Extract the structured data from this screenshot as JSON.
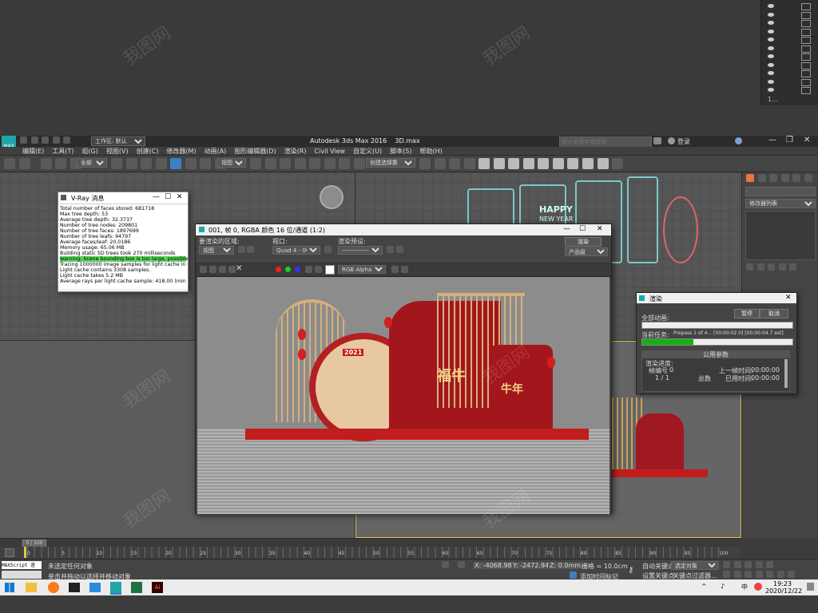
{
  "topright_panel": {
    "rows": 11,
    "ellipsis": "1..."
  },
  "app": {
    "title": "Autodesk 3ds Max 2016",
    "file": "3D.max",
    "logo": "MAX",
    "workspace": "工作区: 默认",
    "search_placeholder": "键入关键字或短语",
    "login": "登录",
    "menu": [
      "编辑(E)",
      "工具(T)",
      "组(G)",
      "视图(V)",
      "创建(C)",
      "修改器(M)",
      "动画(A)",
      "图形编辑器(D)",
      "渲染(R)",
      "Civil View",
      "自定义(U)",
      "脚本(S)",
      "帮助(H)"
    ],
    "filter_all": "全部",
    "view_dropdown": "视图",
    "selection_set": "创建选择集",
    "modifier_list": "修改器列表"
  },
  "viewport_text": {
    "happy": "HAPPY",
    "new_year": "NEW YEAR"
  },
  "vray_log": {
    "title": "V-Ray 消息",
    "lines": [
      "Total number of faces stored: 681718",
      "Max tree depth: 53",
      "Average tree depth: 32.3737",
      "Number of tree nodes: 209801",
      "Number of tree faces: 1897699",
      "Number of tree leafs: 94797",
      "Average faces/leaf: 20.0186",
      "Memory usage: 65.06 MB",
      "Building static SD trees took 270 milliseconds"
    ],
    "warning": "warning: Scene bounding box is too large, possible raycast e",
    "lines2": [
      "Tracing 1000000 image samples for light cache in 64 passes",
      "Light cache contains 3308 samples.",
      "Light cache takes 5.2 MB",
      "Average rays per light cache sample: 418.00 (min 1, max 34"
    ]
  },
  "frame_buffer": {
    "title": "001, 帧 0, RGBA 颜色 16 位/通道 (1:2)",
    "area_label": "要渲染的区域:",
    "area_value": "视图",
    "viewport_label": "视口:",
    "viewport_value": "Quad 4 - 001",
    "preset_label": "渲染预设:",
    "preset_value": "-------------------",
    "render_button": "渲染",
    "product_level": "产品级",
    "channel": "RGB Alpha",
    "poster_year": "2021",
    "caption1": "福牛",
    "caption2": "牛年"
  },
  "render_progress": {
    "title": "渲染",
    "pause": "暂停",
    "cancel": "取消",
    "all_animation": "全部动画:",
    "current_task_label": "当前任务:",
    "current_task_value": "Prepass 1 of 4... [00:00:02.0] [00:00:04.7 est]",
    "progress_fraction": 0.34,
    "section": "公用参数",
    "render_progress_label": "渲染进度:",
    "frame_number_label": "帧编号",
    "frame_number_value": "0",
    "last_frame_time_label": "上一帧时间:",
    "last_frame_time_value": "00:00:00",
    "frame_count": "1 / 1",
    "total_label": "总数",
    "elapsed_label": "已用时间:",
    "elapsed_value": "00:00:00"
  },
  "timeline": {
    "frame_indicator": "0 / 100",
    "ticks": [
      "0",
      "5",
      "10",
      "15",
      "20",
      "25",
      "30",
      "35",
      "40",
      "45",
      "50",
      "55",
      "60",
      "65",
      "70",
      "75",
      "80",
      "85",
      "90",
      "95",
      "100"
    ]
  },
  "status": {
    "maxscript": "MAXScript 迷",
    "no_selection": "未选定任何对象",
    "hint": "单击并拖动以选择并移动对象",
    "x": "X: -4068.983",
    "y": "Y: -2472.94",
    "z": "Z: 0.0mm",
    "grid": "栅格 = 10.0cm",
    "add_time_tag": "添加时间标记",
    "auto_key": "自动关键点",
    "set_key": "设置关键点",
    "selected_object": "选定对象",
    "key_filter": "关键点过滤器..."
  },
  "taskbar": {
    "time": "19:23",
    "date": "2020/12/22",
    "tray_lang": "中",
    "colors": {
      "start": "#ffffff",
      "max": "#1fa6a6",
      "excel": "#1d7145",
      "ai": "#ff7c00"
    }
  },
  "watermark": "我图网"
}
